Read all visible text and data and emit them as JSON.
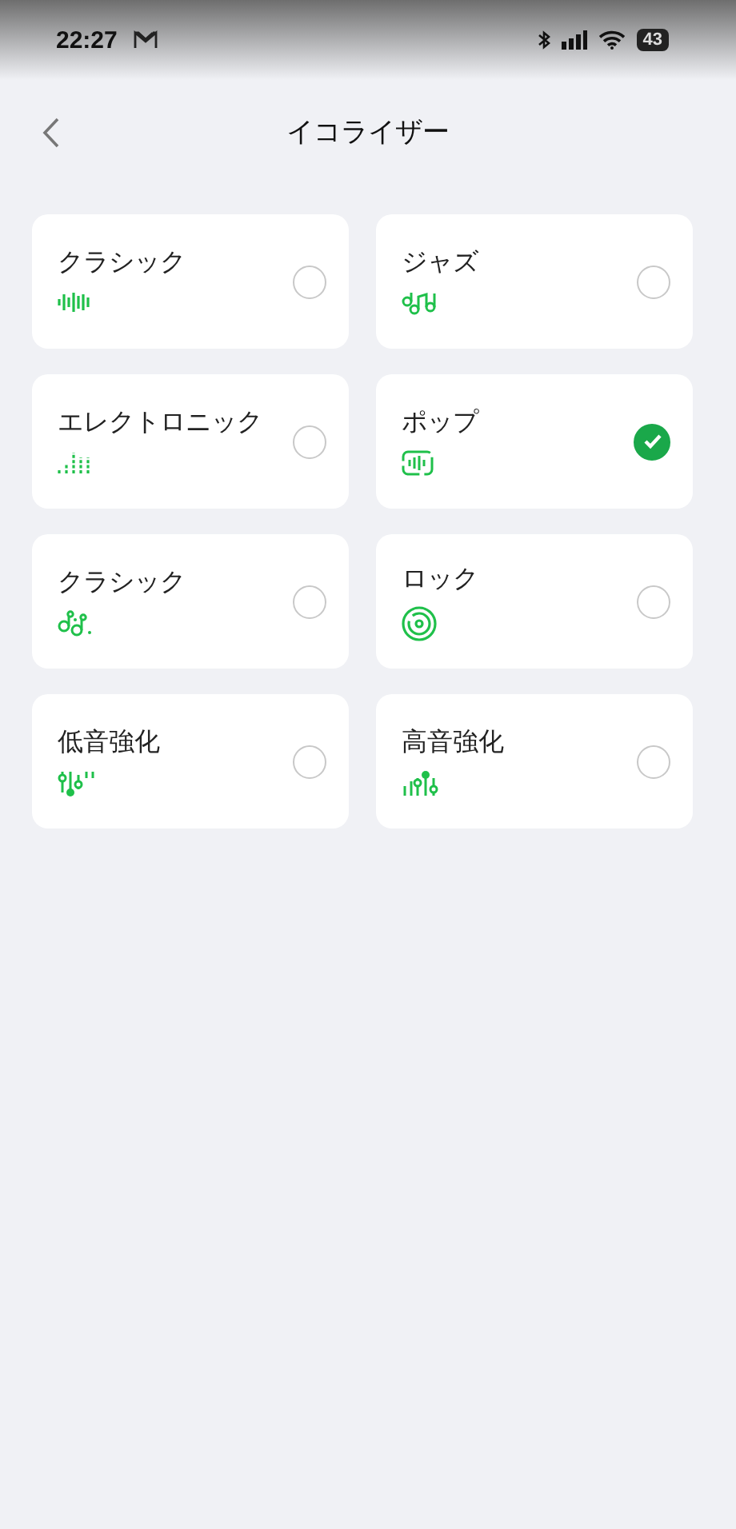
{
  "status_bar": {
    "time": "22:27",
    "battery": "43"
  },
  "header": {
    "title": "イコライザー"
  },
  "presets": [
    {
      "label": "クラシック",
      "kind": "waveform",
      "selected": false
    },
    {
      "label": "ジャズ",
      "kind": "notes",
      "selected": false
    },
    {
      "label": "エレクトロニック",
      "kind": "levels",
      "selected": false
    },
    {
      "label": "ポップ",
      "kind": "framed-wave",
      "selected": true
    },
    {
      "label": "クラシック",
      "kind": "note-pair",
      "selected": false
    },
    {
      "label": "ロック",
      "kind": "disc",
      "selected": false
    },
    {
      "label": "低音強化",
      "kind": "sliders-low",
      "selected": false
    },
    {
      "label": "高音強化",
      "kind": "sliders-high",
      "selected": false
    }
  ]
}
